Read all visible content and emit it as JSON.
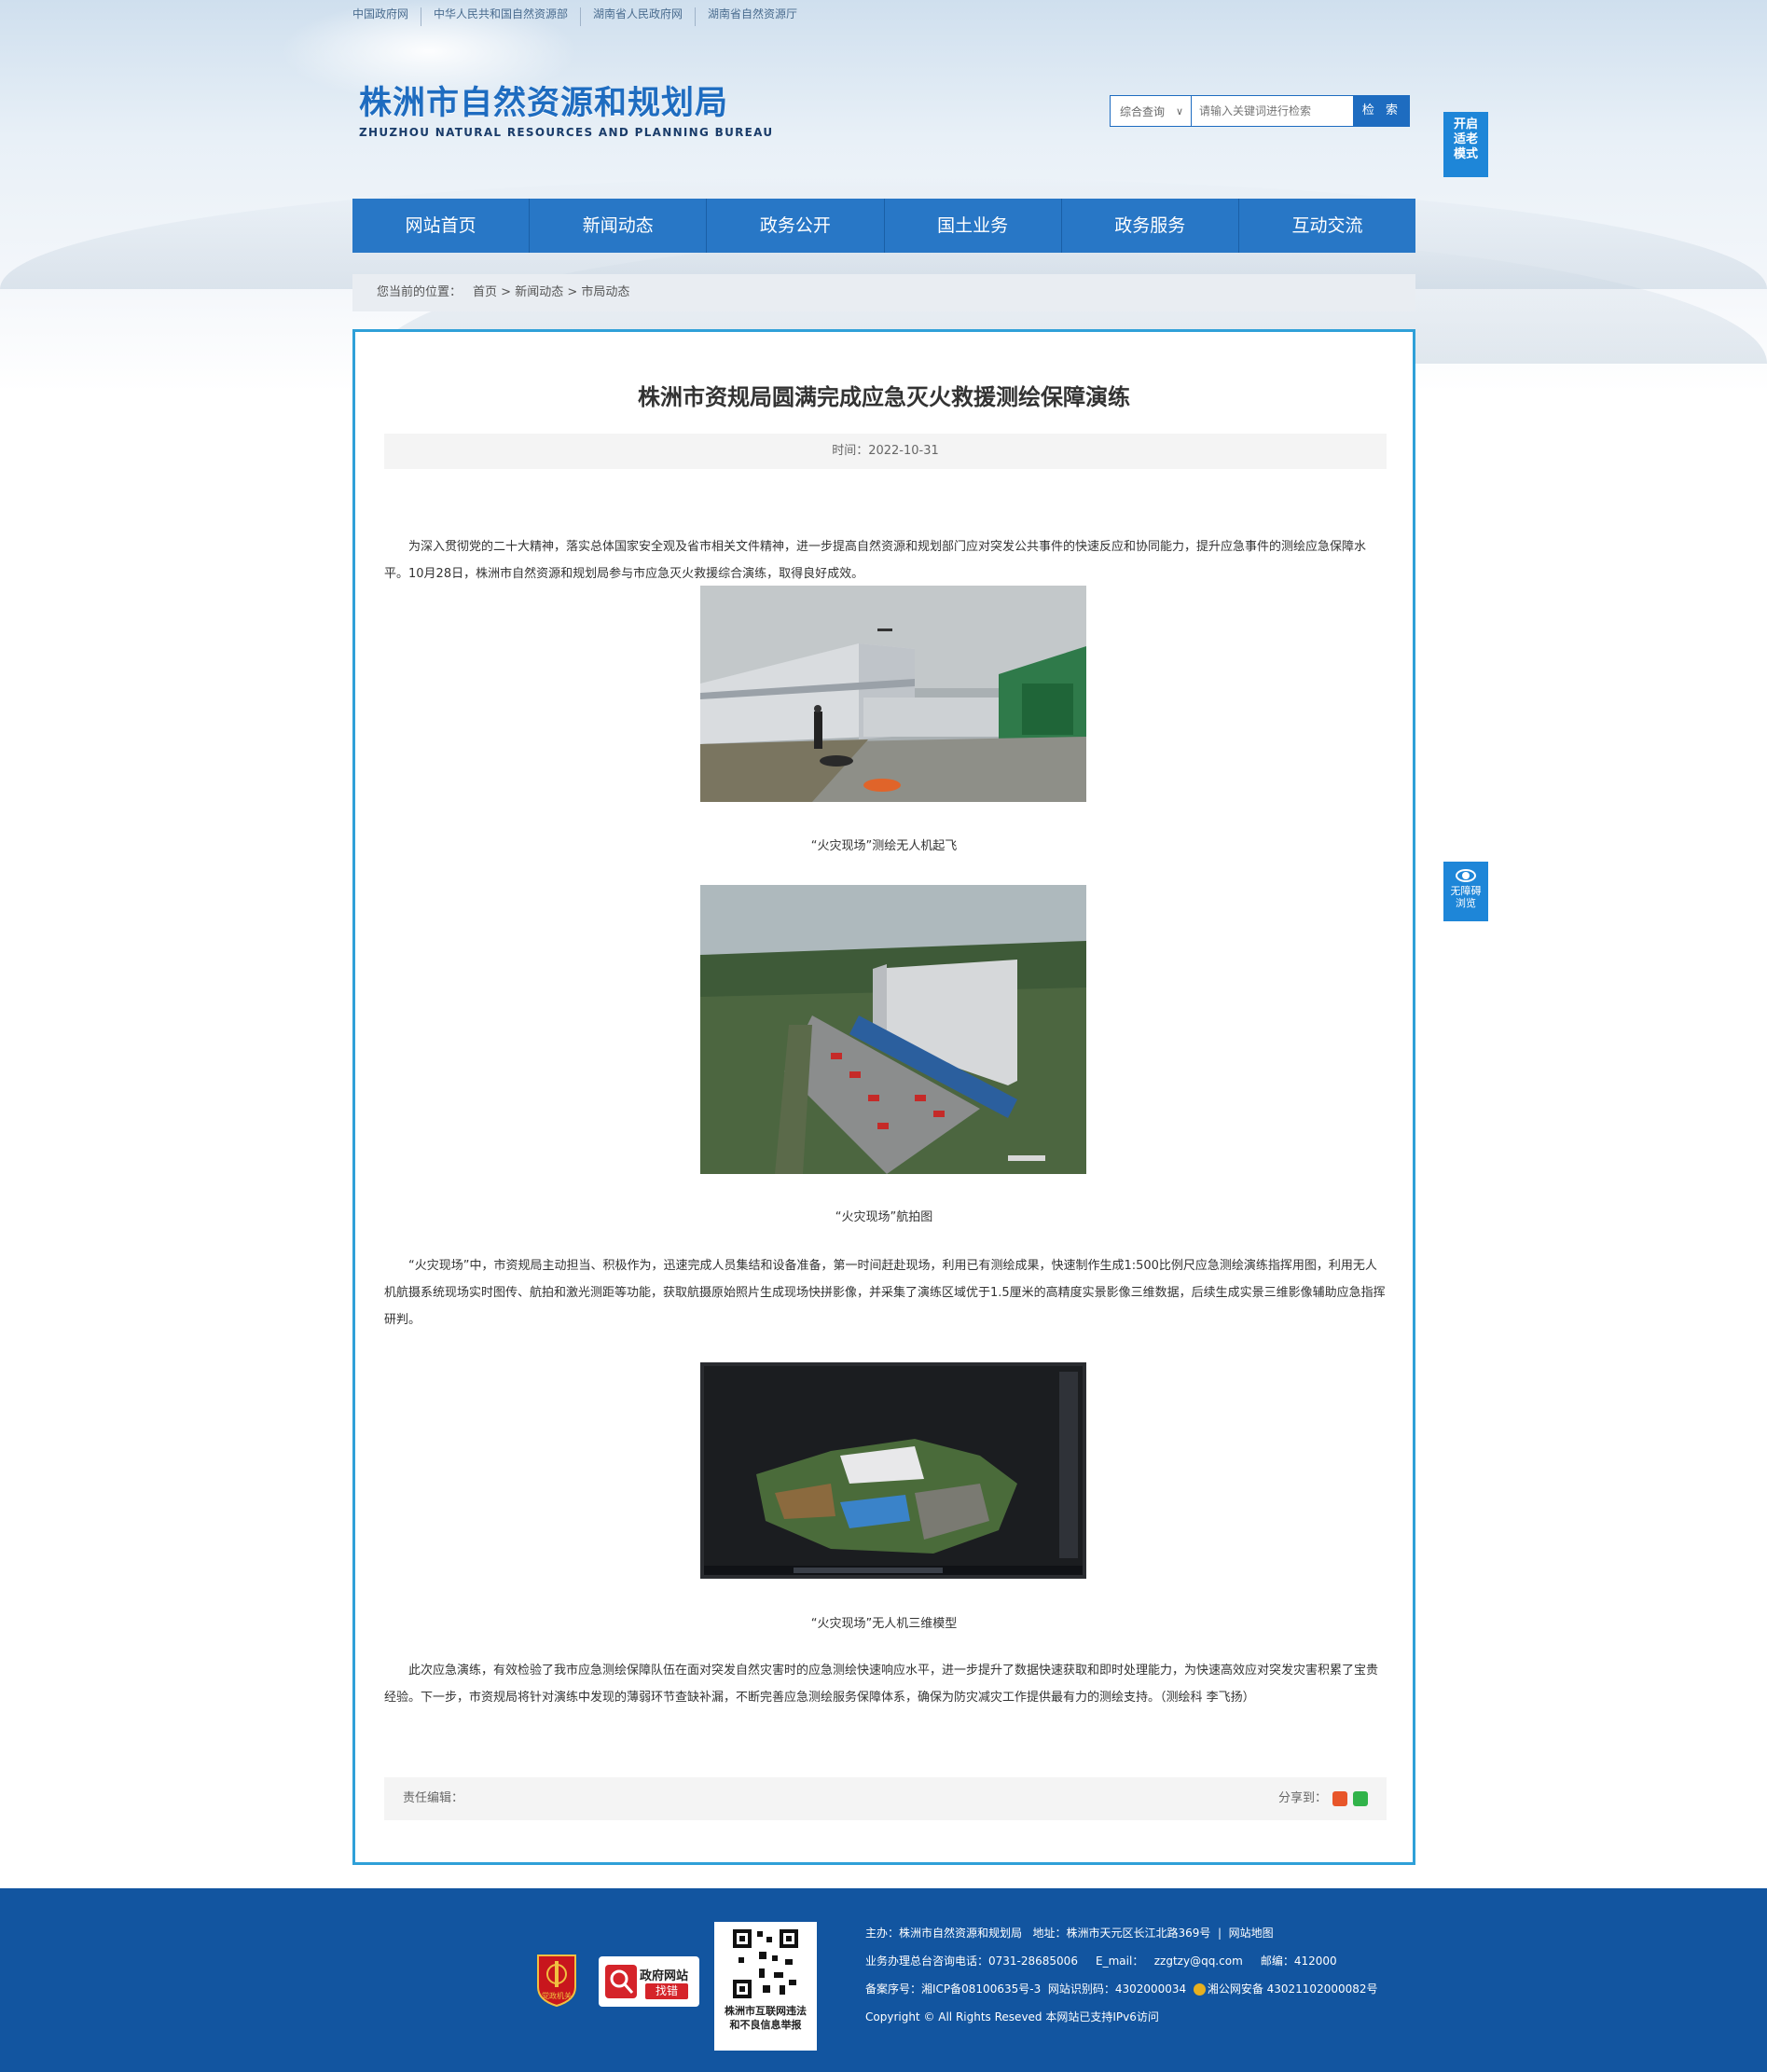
{
  "top_links": [
    "中国政府网",
    "中华人民共和国自然资源部",
    "湖南省人民政府网",
    "湖南省自然资源厅"
  ],
  "logo": {
    "cn": "株洲市自然资源和规划局",
    "en": "ZHUZHOU NATURAL RESOURCES AND PLANNING BUREAU"
  },
  "search": {
    "scope": "综合查询",
    "placeholder": "请输入关键词进行检索",
    "button": "检 索"
  },
  "elder_mode": [
    "开启",
    "适老",
    "模式"
  ],
  "accessibility": [
    "无障碍",
    "浏览"
  ],
  "nav": [
    "网站首页",
    "新闻动态",
    "政务公开",
    "国土业务",
    "政务服务",
    "互动交流"
  ],
  "breadcrumb": {
    "prefix": "您当前的位置：",
    "items": [
      "首页",
      "新闻动态",
      "市局动态"
    ],
    "sep": " > "
  },
  "article": {
    "title": "株洲市资规局圆满完成应急灭火救援测绘保障演练",
    "time": "时间：2022-10-31",
    "para1": "为深入贯彻党的二十大精神，落实总体国家安全观及省市相关文件精神，进一步提高自然资源和规划部门应对突发公共事件的快速反应和协同能力，提升应急事件的测绘应急保障水平。10月28日，株洲市自然资源和规划局参与市应急灭火救援综合演练，取得良好成效。",
    "caption1": "“火灾现场”测绘无人机起飞",
    "caption2": "“火灾现场”航拍图",
    "para2": "“火灾现场”中，市资规局主动担当、积极作为，迅速完成人员集结和设备准备，第一时间赶赴现场，利用已有测绘成果，快速制作生成1:500比例尺应急测绘演练指挥用图，利用无人机航摄系统现场实时图传、航拍和激光测距等功能，获取航摄原始照片生成现场快拼影像，并采集了演练区域优于1.5厘米的高精度实景影像三维数据，后续生成实景三维影像辅助应急指挥研判。",
    "caption3": "“火灾现场”无人机三维模型",
    "para3": "此次应急演练，有效检验了我市应急测绘保障队伍在面对突发自然灾害时的应急测绘快速响应水平，进一步提升了数据快速获取和即时处理能力，为快速高效应对突发灾害积累了宝贵经验。下一步，市资规局将针对演练中发现的薄弱环节查缺补漏，不断完善应急测绘服务保障体系，确保为防灾减灾工作提供最有力的测绘支持。（测绘科 李飞扬）",
    "editor": "责任编辑：",
    "share": "分享到："
  },
  "footer": {
    "badge_label": "党政机关",
    "error_badge": {
      "line1": "政府网站",
      "line2": "找错"
    },
    "qr_text": [
      "株洲市互联网违法",
      "和不良信息举报"
    ],
    "line1": "主办：株洲市自然资源和规划局   地址：株洲市天元区长江北路369号  |  网站地图",
    "line2": "业务办理总台咨询电话：0731-28685006     E_mail：   zzgtzy@qq.com     邮编：412000",
    "line3a": "备案序号：湘ICP备08100635号-3  网站识别码：4302000034  ",
    "line3b": "湘公网安备 43021102000082号",
    "line4": "Copyright © All Rights Reseved 本网站已支持IPv6访问"
  },
  "colors": {
    "brand_blue": "#2877c6",
    "article_border": "#2fa0d8",
    "footer_blue": "#1255a0"
  }
}
